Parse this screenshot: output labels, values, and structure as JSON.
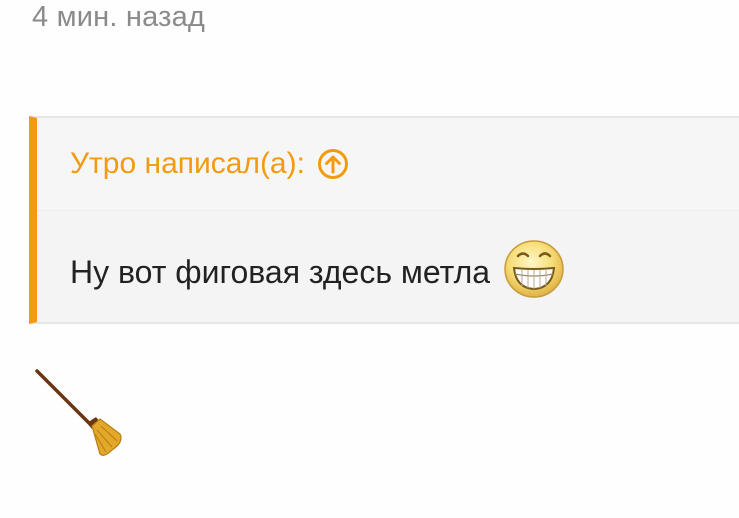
{
  "post": {
    "timestamp": "4 мин. назад"
  },
  "quote": {
    "author_line": "Утро написал(а):",
    "author_icon": "arrow-up-circle-icon",
    "text": "Ну вот фиговая здесь метла",
    "emoji_icon": "grinning-face-icon",
    "accent_color": "#f29b10"
  },
  "reply": {
    "emoji_icon": "broom-icon"
  }
}
